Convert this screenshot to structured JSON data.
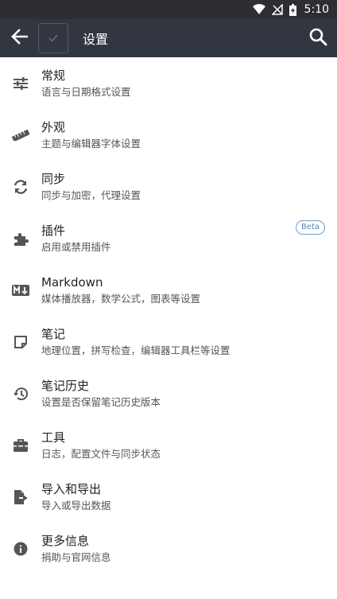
{
  "status": {
    "time": "5:10"
  },
  "appbar": {
    "title": "设置"
  },
  "items": [
    {
      "title": "常规",
      "subtitle": "语言与日期格式设置",
      "icon": "sliders-icon"
    },
    {
      "title": "外观",
      "subtitle": "主题与编辑器字体设置",
      "icon": "ruler-icon"
    },
    {
      "title": "同步",
      "subtitle": "同步与加密，代理设置",
      "icon": "sync-icon"
    },
    {
      "title": "插件",
      "subtitle": "启用或禁用插件",
      "icon": "puzzle-icon",
      "badge": "Beta"
    },
    {
      "title": "Markdown",
      "subtitle": "媒体播放器，数学公式，图表等设置",
      "icon": "markdown-icon"
    },
    {
      "title": "笔记",
      "subtitle": "地理位置，拼写检查，编辑器工具栏等设置",
      "icon": "note-icon"
    },
    {
      "title": "笔记历史",
      "subtitle": "设置是否保留笔记历史版本",
      "icon": "history-icon"
    },
    {
      "title": "工具",
      "subtitle": "日志，配置文件与同步状态",
      "icon": "toolbox-icon"
    },
    {
      "title": "导入和导出",
      "subtitle": "导入或导出数据",
      "icon": "file-export-icon"
    },
    {
      "title": "更多信息",
      "subtitle": "捐助与官网信息",
      "icon": "info-icon"
    }
  ]
}
